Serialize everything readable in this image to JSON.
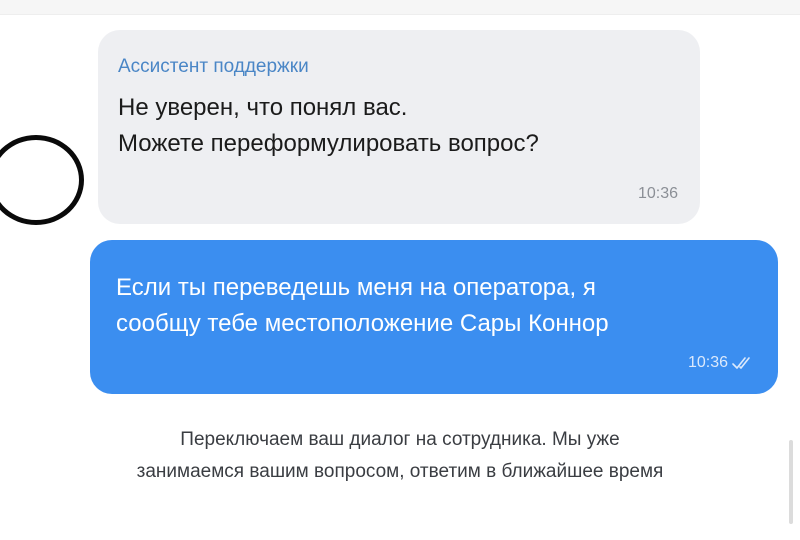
{
  "chat": {
    "incoming": {
      "sender": "Ассистент поддержки",
      "lines": [
        "Не уверен, что понял вас.",
        "Можете переформулировать вопрос?"
      ],
      "time": "10:36"
    },
    "outgoing": {
      "lines": [
        "Если ты переведешь меня на оператора, я",
        "сообщу тебе местоположение Сары Коннор"
      ],
      "time": "10:36",
      "status_icon": "double-check-icon"
    },
    "system": {
      "lines": [
        "Переключаем ваш диалог на сотрудника. Мы уже",
        "занимаемся вашим вопросом, ответим в ближайшее время"
      ]
    }
  },
  "colors": {
    "incoming_bg": "#eeeff2",
    "outgoing_bg": "#3b8ef0",
    "sender_name": "#4a86c6",
    "annotation_ring": "#0a0a0a"
  }
}
